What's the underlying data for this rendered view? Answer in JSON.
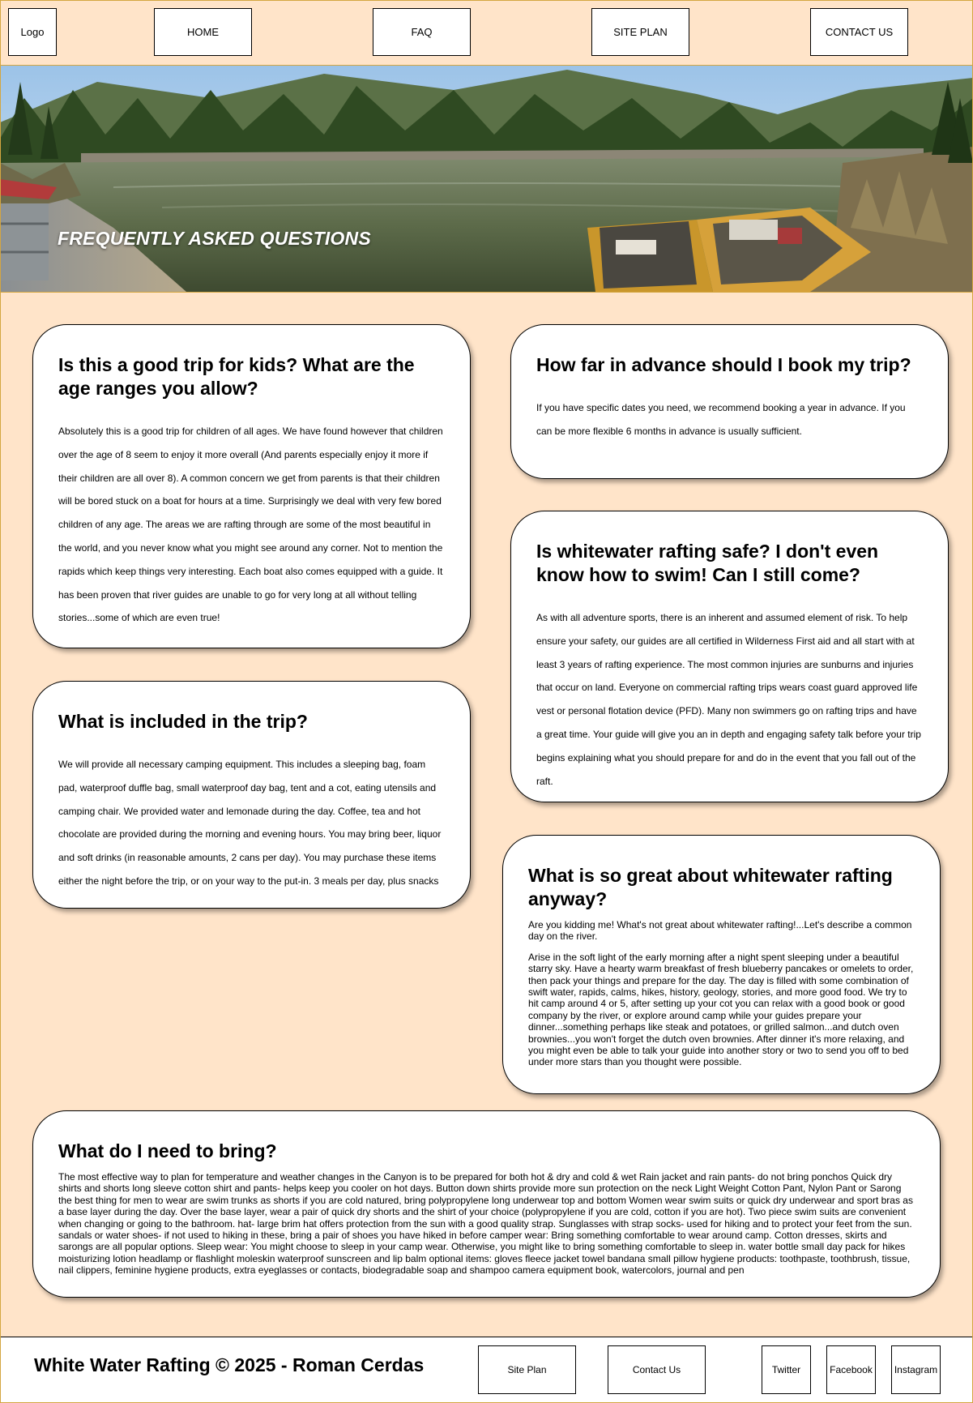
{
  "nav": {
    "logo": "Logo",
    "items": [
      {
        "label": "HOME"
      },
      {
        "label": "FAQ"
      },
      {
        "label": "SITE PLAN"
      },
      {
        "label": "CONTACT US"
      }
    ]
  },
  "hero": {
    "title": "FREQUENTLY ASKED QUESTIONS"
  },
  "faq": {
    "kids": {
      "question": "Is this a good trip for kids? What are the age ranges you allow?",
      "answer": "Absolutely this is a good trip for children of all ages. We have found however that children over the age of 8 seem to enjoy it more overall (And parents especially enjoy it more if their children are all over 8). A common concern we get from parents is that their children will be bored stuck on a boat for hours at a time. Surprisingly we deal with very few bored children of any age. The areas we are rafting through are some of the most beautiful in the world, and you never know what you might see around any corner. Not to mention the rapids which keep things very interesting. Each boat also comes equipped with a guide. It has been proven that river guides are unable to go for very long at all without telling stories...some of which are even true!"
    },
    "advance": {
      "question": "How far in advance should I book my trip?",
      "answer": "If you have specific dates you need, we recommend booking a year in advance. If you can be more flexible 6 months in advance is usually sufficient."
    },
    "safe": {
      "question": "Is whitewater rafting safe? I don't even know how to swim! Can I still come?",
      "answer": "As with all adventure sports, there is an inherent and assumed element of risk. To help ensure your safety, our guides are all certified in Wilderness First aid and all start with at least 3 years of rafting experience. The most common injuries are sunburns and injuries that occur on land. Everyone on commercial rafting trips wears coast guard approved life vest or personal flotation device (PFD). Many non swimmers go on rafting trips and have a great time. Your guide will give you an in depth and engaging safety talk before your trip begins explaining what you should prepare for and do in the event that you fall out of the raft."
    },
    "included": {
      "question": "What is included in the trip?",
      "answer": "We will provide all necessary camping equipment. This includes a sleeping bag, foam pad, waterproof duffle bag, small waterproof day bag, tent and a cot, eating utensils and camping chair. We provided water and lemonade during the day. Coffee, tea and hot chocolate are provided during the morning and evening hours. You may bring beer, liquor and soft drinks (in reasonable amounts, 2 cans per day). You may purchase these items either the night before the trip, or on your way to the put-in. 3 meals per day, plus snacks"
    },
    "great": {
      "question": "What is so great about whitewater rafting anyway?",
      "answer1": "Are you kidding me! What's not great about whitewater rafting!...Let's describe a common day on the river.",
      "answer2": "Arise in the soft light of the early morning after a night spent sleeping under a beautiful starry sky. Have a hearty warm breakfast of fresh blueberry pancakes or omelets to order, then pack your things and prepare for the day. The day is filled with some combination of swift water, rapids, calms, hikes, history, geology, stories, and more good food. We try to hit camp around 4 or 5, after setting up your cot you can relax with a good book or good company by the river, or explore around camp while your guides prepare your dinner...something perhaps like steak and potatoes, or grilled salmon...and dutch oven brownies...you won't forget the dutch oven brownies. After dinner it's more relaxing, and you might even be able to talk your guide into another story or two to send you off to bed under more stars than you thought were possible."
    },
    "bring": {
      "question": "What do I need to bring?",
      "answer": "The most effective way to plan for temperature and weather changes in the Canyon is to be prepared for both hot & dry and cold & wet Rain jacket and rain pants- do not bring ponchos Quick dry shirts and shorts long sleeve cotton shirt and pants- helps keep you cooler on hot days. Button down shirts provide more sun protection on the neck Light Weight Cotton Pant, Nylon Pant or Sarong the best thing for men to wear are swim trunks as shorts if you are cold natured, bring polypropylene long underwear top and bottom Women wear swim suits or quick dry underwear and sport bras as a base layer during the day. Over the base layer, wear a pair of quick dry shorts and the shirt of your choice (polypropylene if you are cold, cotton if you are hot). Two piece swim suits are convenient when changing or going to the bathroom. hat- large brim hat offers protection from the sun with a good quality strap. Sunglasses with strap socks- used for hiking and to protect your feet from the sun. sandals or water shoes- if not used to hiking in these, bring a pair of shoes you have hiked in before camper wear: Bring something comfortable to wear around camp. Cotton dresses, skirts and sarongs are all popular options. Sleep wear: You might choose to sleep in your camp wear. Otherwise, you might like to bring something comfortable to sleep in. water bottle small day pack for hikes moisturizing lotion headlamp or flashlight moleskin waterproof sunscreen and lip balm optional items: gloves fleece jacket towel bandana small pillow hygiene products: toothpaste, toothbrush, tissue, nail clippers, feminine hygiene products, extra eyeglasses or contacts, biodegradable soap and shampoo camera equipment book, watercolors, journal and pen"
    }
  },
  "footer": {
    "title": "White Water Rafting © 2025 - Roman Cerdas",
    "links": [
      {
        "label": "Site Plan"
      },
      {
        "label": "Contact Us"
      }
    ],
    "social": [
      {
        "label": "Twitter"
      },
      {
        "label": "Facebook"
      },
      {
        "label": "Instagram"
      }
    ]
  },
  "colors": {
    "page_background": "#ffe4c9",
    "accent_border": "#d4a640",
    "card_background": "#ffffff"
  }
}
